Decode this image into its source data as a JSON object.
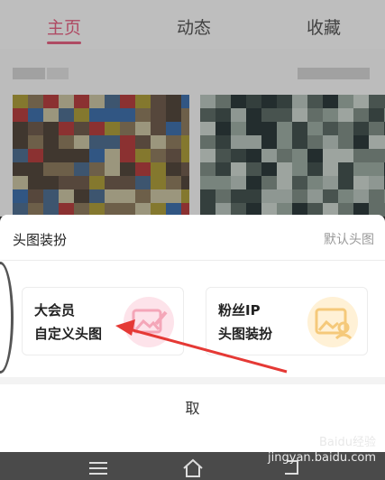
{
  "tabs": [
    {
      "label": "主页",
      "active": true
    },
    {
      "label": "动态",
      "active": false
    },
    {
      "label": "收藏",
      "active": false
    }
  ],
  "sheet": {
    "title": "头图装扮",
    "default_label": "默认头图",
    "cards": [
      {
        "line1": "大会员",
        "line2": "自定义头图",
        "icon": "image-edit-icon"
      },
      {
        "line1": "粉丝IP",
        "line2": "头图装扮",
        "icon": "image-person-icon"
      }
    ],
    "cancel_label": "取"
  },
  "watermark": {
    "line1": "Baidu经验",
    "line2": "jingyan.baidu.com"
  },
  "colors": {
    "accent": "#e06080",
    "arrow": "#e53935"
  }
}
